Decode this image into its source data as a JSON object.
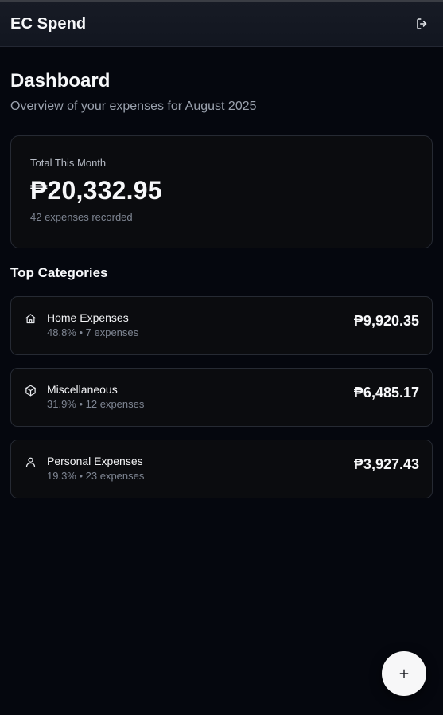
{
  "header": {
    "app_title": "EC Spend",
    "logout_icon": "logout-icon"
  },
  "dashboard": {
    "title": "Dashboard",
    "subtitle": "Overview of your expenses for August 2025"
  },
  "total": {
    "label": "Total This Month",
    "amount": "₱20,332.95",
    "count_text": "42 expenses recorded"
  },
  "top_categories": {
    "title": "Top Categories",
    "items": [
      {
        "icon": "home-icon",
        "name": "Home Expenses",
        "meta": "48.8% • 7 expenses",
        "amount": "₱9,920.35"
      },
      {
        "icon": "box-icon",
        "name": "Miscellaneous",
        "meta": "31.9% • 12 expenses",
        "amount": "₱6,485.17"
      },
      {
        "icon": "user-icon",
        "name": "Personal Expenses",
        "meta": "19.3% • 23 expenses",
        "amount": "₱3,927.43"
      }
    ]
  },
  "fab": {
    "icon": "plus-icon"
  },
  "colors": {
    "background": "#05070e",
    "card": "#0b0c0f",
    "header": "#151923",
    "border": "#262a33",
    "text_primary": "#f7f8fa",
    "text_muted": "#7f8693",
    "fab_bg": "#f7f7f8"
  }
}
